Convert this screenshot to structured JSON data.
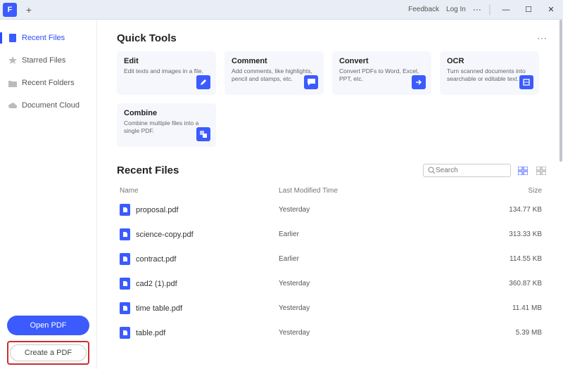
{
  "titlebar": {
    "feedback": "Feedback",
    "login": "Log In"
  },
  "sidebar": {
    "items": [
      {
        "label": "Recent Files",
        "icon": "recent-icon",
        "active": true
      },
      {
        "label": "Starred Files",
        "icon": "star-icon",
        "active": false
      },
      {
        "label": "Recent Folders",
        "icon": "folder-icon",
        "active": false
      },
      {
        "label": "Document Cloud",
        "icon": "cloud-icon",
        "active": false
      }
    ],
    "open_label": "Open PDF",
    "create_label": "Create a PDF"
  },
  "quick_tools": {
    "title": "Quick Tools",
    "cards": [
      {
        "title": "Edit",
        "desc": "Edit texts and images in a file."
      },
      {
        "title": "Comment",
        "desc": "Add comments, like highlights, pencil and stamps, etc."
      },
      {
        "title": "Convert",
        "desc": "Convert PDFs to Word, Excel, PPT, etc."
      },
      {
        "title": "OCR",
        "desc": "Turn scanned documents into searchable or editable text."
      },
      {
        "title": "Combine",
        "desc": "Combine multiple files into a single PDF."
      }
    ]
  },
  "recent_files": {
    "title": "Recent Files",
    "search_placeholder": "Search",
    "columns": {
      "name": "Name",
      "time": "Last Modified Time",
      "size": "Size"
    },
    "rows": [
      {
        "name": "proposal.pdf",
        "time": "Yesterday",
        "size": "134.77 KB"
      },
      {
        "name": "science-copy.pdf",
        "time": "Earlier",
        "size": "313.33 KB"
      },
      {
        "name": "contract.pdf",
        "time": "Earlier",
        "size": "114.55 KB"
      },
      {
        "name": "cad2 (1).pdf",
        "time": "Yesterday",
        "size": "360.87 KB"
      },
      {
        "name": "time table.pdf",
        "time": "Yesterday",
        "size": "11.41 MB"
      },
      {
        "name": "table.pdf",
        "time": "Yesterday",
        "size": "5.39 MB"
      }
    ]
  }
}
